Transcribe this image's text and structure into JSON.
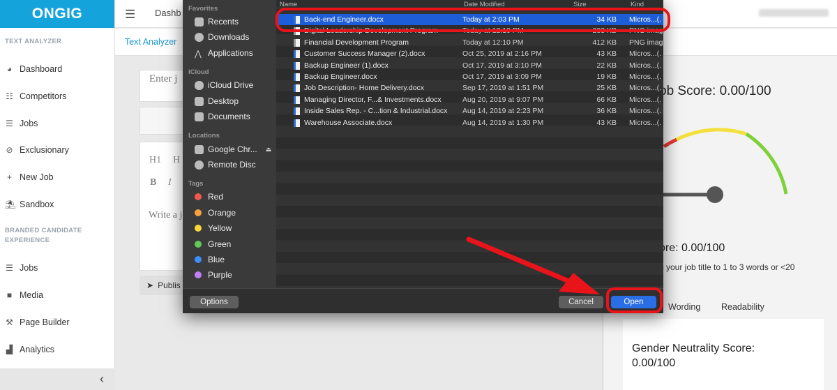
{
  "app": {
    "logo": "ONGIG",
    "header_dashboard": "Dashb",
    "breadcrumb": "Text Analyzer"
  },
  "sidebar": {
    "section_text_analyzer": "TEXT ANALYZER",
    "items_main": [
      {
        "label": "Dashboard",
        "icon": "palette-icon"
      },
      {
        "label": "Competitors",
        "icon": "users-icon"
      },
      {
        "label": "Jobs",
        "icon": "list-icon"
      },
      {
        "label": "Exclusionary",
        "icon": "ban-icon"
      },
      {
        "label": "New Job",
        "icon": "plus-icon"
      },
      {
        "label": "Sandbox",
        "icon": "beach-icon"
      }
    ],
    "section_branded_1": "BRANDED CANDIDATE",
    "section_branded_2": "EXPERIENCE",
    "items_branded": [
      {
        "label": "Jobs",
        "icon": "list-icon"
      },
      {
        "label": "Media",
        "icon": "video-icon"
      },
      {
        "label": "Page Builder",
        "icon": "hammer-icon"
      },
      {
        "label": "Analytics",
        "icon": "chart-icon"
      }
    ],
    "collapse": "‹"
  },
  "editor": {
    "title_placeholder": "Enter j",
    "h1": "H1",
    "h2": "H",
    "bold": "B",
    "italic": "I",
    "body_placeholder": "Write a j",
    "publish": "Publis"
  },
  "score": {
    "title": "ob Score: 0.00/100",
    "sub": "ore: 0.00/100",
    "tip_line1": "o your job title to 1 to 3 words or <20",
    "tip_line2": ".",
    "tabs": [
      "Wording",
      "Readability"
    ],
    "gender_title": "Gender Neutrality Score:",
    "gender_value": "0.00/100",
    "gauge_colors": [
      "#e53935",
      "#f4e03c",
      "#7fd13b"
    ]
  },
  "dialog": {
    "favorites_label": "Favorites",
    "favorites": [
      "Recents",
      "Downloads",
      "Applications"
    ],
    "icloud_label": "iCloud",
    "icloud": [
      "iCloud Drive",
      "Desktop",
      "Documents"
    ],
    "locations_label": "Locations",
    "locations": [
      "Google Chr...",
      "Remote Disc"
    ],
    "tags_label": "Tags",
    "tags": [
      {
        "name": "Red",
        "color": "#f0584f"
      },
      {
        "name": "Orange",
        "color": "#f7a23b"
      },
      {
        "name": "Yellow",
        "color": "#f6d63b"
      },
      {
        "name": "Green",
        "color": "#5fcb55"
      },
      {
        "name": "Blue",
        "color": "#3b8ff7"
      },
      {
        "name": "Purple",
        "color": "#c17ef2"
      }
    ],
    "columns": {
      "name": "Name",
      "date": "Date Modified",
      "size": "Size",
      "kind": "Kind"
    },
    "files": [
      {
        "name": "Back-end Engineer.docx",
        "date": "Today at 2:03 PM",
        "size": "34 KB",
        "kind": "Micros...(.",
        "type": "doc"
      },
      {
        "name": "Digital Leadership Development Program",
        "date": "Today at 12:10 PM",
        "size": "283 KB",
        "kind": "PNG imag",
        "type": "img"
      },
      {
        "name": "Financial Development Program",
        "date": "Today at 12:10 PM",
        "size": "412 KB",
        "kind": "PNG imag",
        "type": "img"
      },
      {
        "name": "Customer Success Manager (2).docx",
        "date": "Oct 25, 2019 at 2:16 PM",
        "size": "43 KB",
        "kind": "Micros...(.",
        "type": "doc"
      },
      {
        "name": "Backup Engineer (1).docx",
        "date": "Oct 17, 2019 at 3:10 PM",
        "size": "22 KB",
        "kind": "Micros...(.",
        "type": "doc"
      },
      {
        "name": "Backup Engineer.docx",
        "date": "Oct 17, 2019 at 3:09 PM",
        "size": "19 KB",
        "kind": "Micros...(.",
        "type": "doc"
      },
      {
        "name": "Job Description- Home Delivery.docx",
        "date": "Sep 17, 2019 at 1:51 PM",
        "size": "25 KB",
        "kind": "Micros...(.",
        "type": "doc"
      },
      {
        "name": "Managing Director, F...& Investments.docx",
        "date": "Aug 20, 2019 at 9:07 PM",
        "size": "66 KB",
        "kind": "Micros...(.",
        "type": "doc"
      },
      {
        "name": "Inside Sales Rep. - C...tion & Industrial.docx",
        "date": "Aug 14, 2019 at 2:23 PM",
        "size": "36 KB",
        "kind": "Micros...(.",
        "type": "doc"
      },
      {
        "name": "Warehouse Associate.docx",
        "date": "Aug 14, 2019 at 1:30 PM",
        "size": "43 KB",
        "kind": "Micros...(.",
        "type": "doc"
      }
    ],
    "options": "Options",
    "cancel": "Cancel",
    "open": "Open"
  },
  "colors": {
    "brand": "#15a3dc",
    "annotation": "#e8141a",
    "selection": "#1d5ed8"
  }
}
